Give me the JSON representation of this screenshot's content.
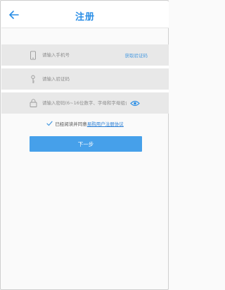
{
  "header": {
    "title": "注册",
    "back_icon": "arrow-left-icon"
  },
  "form": {
    "phone": {
      "placeholder": "请输入手机号",
      "value": "",
      "icon": "phone-icon"
    },
    "get_code_label": "获取验证码",
    "code": {
      "placeholder": "请输入验证码",
      "value": "",
      "icon": "key-icon"
    },
    "password": {
      "placeholder": "请输入密码(6~16位数字、字母和字母组合)",
      "value": "",
      "icon": "lock-icon",
      "toggle_icon": "eye-icon"
    }
  },
  "agreement": {
    "checked": true,
    "prefix": "已经阅读并同意",
    "link": "易购用户注册协议"
  },
  "next_button": {
    "label": "下一步"
  },
  "colors": {
    "accent": "#2a8ee6",
    "button": "#46a0ea",
    "field_bg": "#e8e8e8"
  }
}
